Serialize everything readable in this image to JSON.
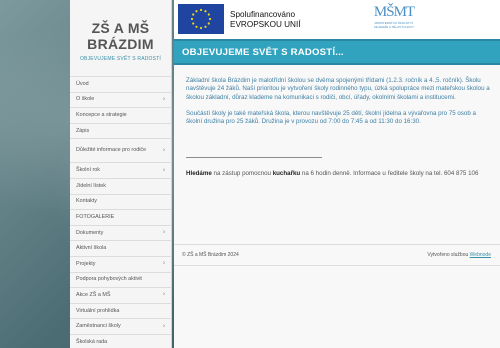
{
  "brand": {
    "title_line1": "ZŠ A MŠ",
    "title_line2": "BRÁZDIM",
    "subtitle": "OBJEVUJEME SVĚT S RADOSTÍ"
  },
  "nav": [
    {
      "label": "Úvod",
      "chevron": false,
      "lines": 1
    },
    {
      "label": "O škole",
      "chevron": true,
      "lines": 1
    },
    {
      "label": "Koncepce a strategie",
      "chevron": false,
      "lines": 1
    },
    {
      "label": "Zápis",
      "chevron": false,
      "lines": 1
    },
    {
      "label": "Důležité informace pro rodiče",
      "chevron": true,
      "lines": 2
    },
    {
      "label": "Školní rok",
      "chevron": true,
      "lines": 1
    },
    {
      "label": "Jídelní lístek",
      "chevron": false,
      "lines": 1
    },
    {
      "label": "Kontakty",
      "chevron": false,
      "lines": 1
    },
    {
      "label": "FOTOGALERIE",
      "chevron": false,
      "lines": 1
    },
    {
      "label": "Dokumenty",
      "chevron": true,
      "lines": 1
    },
    {
      "label": "Aktivní škola",
      "chevron": false,
      "lines": 1
    },
    {
      "label": "Projekty",
      "chevron": true,
      "lines": 1
    },
    {
      "label": "Podpora pohybových aktivit",
      "chevron": false,
      "lines": 1
    },
    {
      "label": "Akce ZŠ a MŠ",
      "chevron": true,
      "lines": 1
    },
    {
      "label": "Virtuální prohlídka",
      "chevron": false,
      "lines": 1
    },
    {
      "label": "Zaměstnanci školy",
      "chevron": true,
      "lines": 1
    },
    {
      "label": "Školská rada",
      "chevron": false,
      "lines": 1
    }
  ],
  "logos": {
    "eu_line1": "Spolufinancováno",
    "eu_line2": "EVROPSKOU UNIÍ",
    "msmt_mark": "MŠMT",
    "msmt_line1": "MINISTERSTVO ŠKOLSTVÍ,",
    "msmt_line2": "MLÁDEŽE A TĚLOVÝCHOVY"
  },
  "heading": "OBJEVUJEME SVĚT S RADOSTÍ...",
  "content": {
    "paragraph1": "Základní škola Brázdim je malotřídní školou se dvěma spojenými třídami (1.2.3. ročník a 4.,5. ročník). Školu navštěvuje 24 žáků. Naší prioritou je vytvoření školy rodinného typu, úzká spolupráce mezi mateřskou školou a školou základní, důraz klademe na komunikaci s rodiči, obcí, úřady, okolními školami a institucemi.",
    "paragraph2": "Součástí školy je také mateřská škola, kterou navštěvuje 25 dětí, školní jídelna a vývařovna pro 75 osob a školní družina pro 25 žáků. Družina je v provozu od 7:00 do 7:45 a od 11:30 do 16:30.",
    "notice_bold1": "Hledáme",
    "notice_text1": " na zástup pomocnou ",
    "notice_bold2": "kuchařku",
    "notice_text2": " na 6 hodin denně. Informace u ředitele školy na tel. 604 875 106"
  },
  "footer": {
    "copyright": "© ZŠ a MŠ Brázdim 2024",
    "created_by": "Vytvořeno službou ",
    "service_link": "Webnode"
  },
  "colors": {
    "accent": "#31a3bf",
    "link": "#3a8fa8",
    "eu_blue": "#1f45a0",
    "eu_star": "#f5d80f",
    "msmt_blue": "#4a8fc4"
  }
}
